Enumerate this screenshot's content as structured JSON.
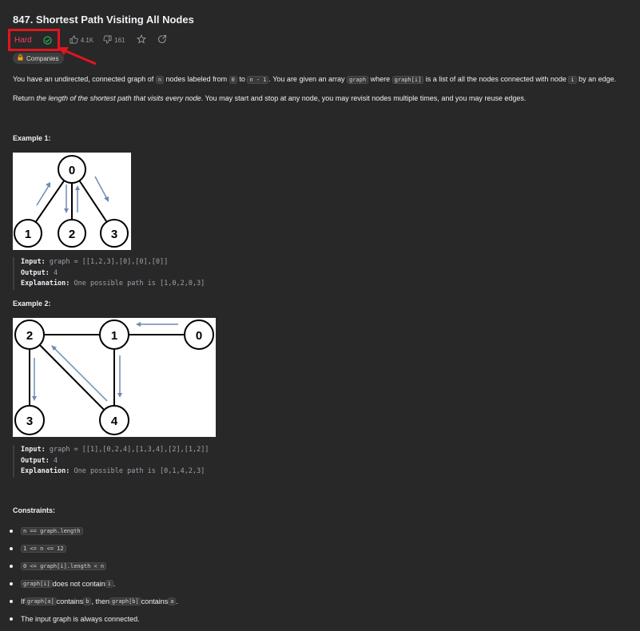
{
  "problem": {
    "title": "847. Shortest Path Visiting All Nodes",
    "difficulty": "Hard",
    "likes": "4.1K",
    "dislikes": "161",
    "companies_label": "Companies"
  },
  "colors": {
    "hard": "#ff375f",
    "annotation": "#e0161e",
    "background": "#282828"
  },
  "desc": {
    "p1": [
      "You have an undirected, connected graph of ",
      "n",
      " nodes labeled from ",
      "0",
      " to ",
      "n - 1",
      ". You are given an array ",
      "graph",
      " where ",
      "graph[i]",
      " is a list of all the nodes connected with node ",
      "i",
      " by an edge."
    ],
    "p2_pre": "Return ",
    "p2_em": "the length of the shortest path that visits every node",
    "p2_post": ". You may start and stop at any node, you may revisit nodes multiple times, and you may reuse edges."
  },
  "examples": [
    {
      "heading": "Example 1:",
      "input_label": "Input:",
      "input": "graph = [[1,2,3],[0],[0],[0]]",
      "output_label": "Output:",
      "output": "4",
      "expl_label": "Explanation:",
      "explanation": "One possible path is [1,0,2,0,3]",
      "nodes": [
        "0",
        "1",
        "2",
        "3"
      ]
    },
    {
      "heading": "Example 2:",
      "input_label": "Input:",
      "input": "graph = [[1],[0,2,4],[1,3,4],[2],[1,2]]",
      "output_label": "Output:",
      "output": "4",
      "expl_label": "Explanation:",
      "explanation": "One possible path is [0,1,4,2,3]",
      "nodes": [
        "2",
        "1",
        "0",
        "3",
        "4"
      ]
    }
  ],
  "constraints_heading": "Constraints:",
  "constraints": [
    [
      {
        "c": "n == graph.length"
      }
    ],
    [
      {
        "c": "1 <= n <= 12"
      }
    ],
    [
      {
        "c": "0 <= graph[i].length < n"
      }
    ],
    [
      {
        "c": "graph[i]"
      },
      {
        "t": " does not contain "
      },
      {
        "c": "i"
      },
      {
        "t": "."
      }
    ],
    [
      {
        "t": "If "
      },
      {
        "c": "graph[a]"
      },
      {
        "t": " contains "
      },
      {
        "c": "b"
      },
      {
        "t": ", then "
      },
      {
        "c": "graph[b]"
      },
      {
        "t": " contains "
      },
      {
        "c": "a"
      },
      {
        "t": "."
      }
    ],
    [
      {
        "t": "The input graph is always connected."
      }
    ]
  ]
}
